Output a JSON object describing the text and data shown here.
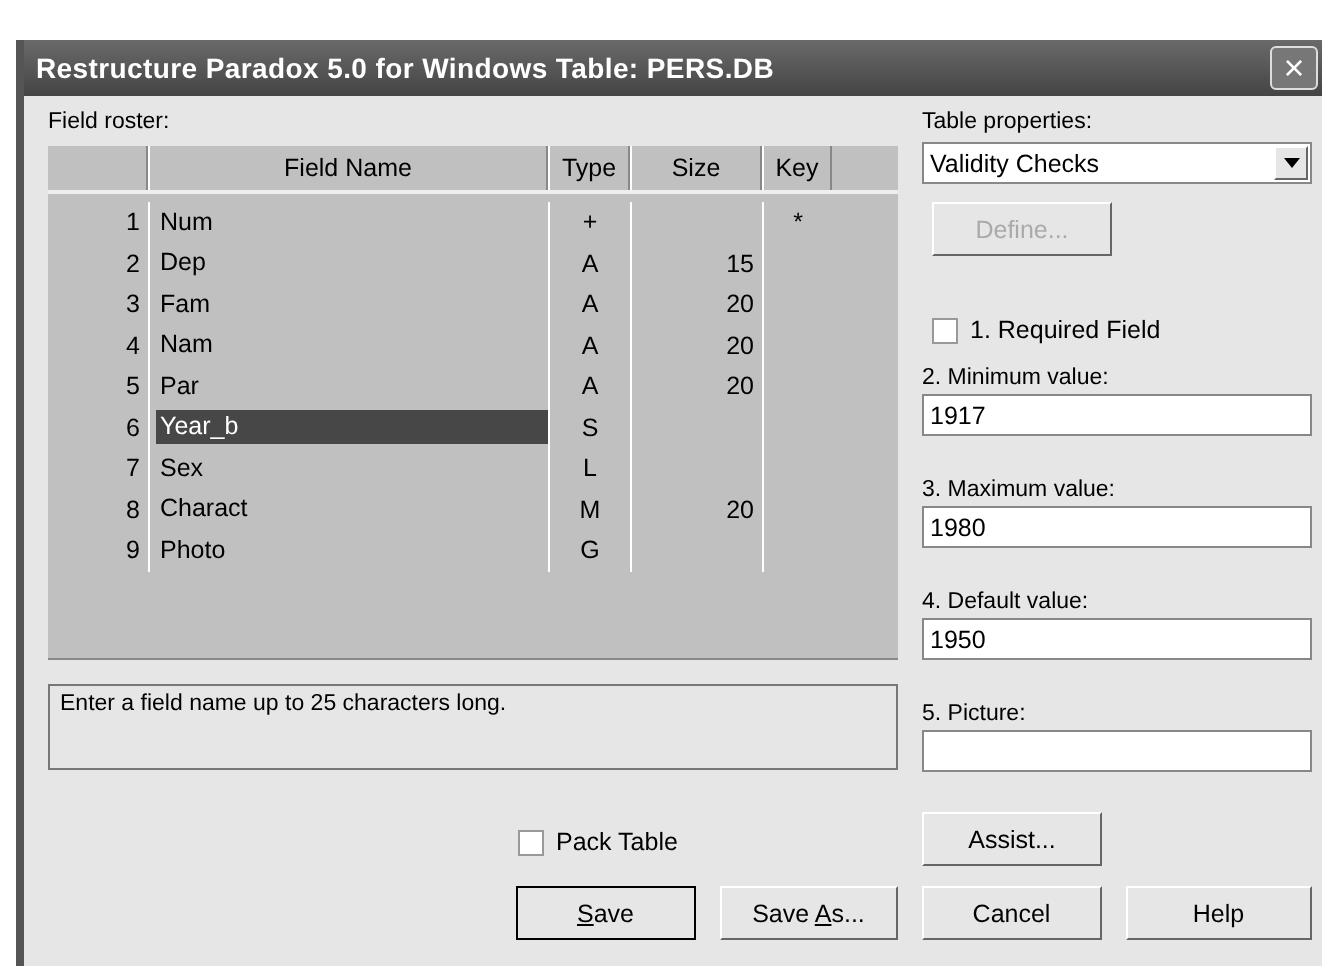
{
  "window": {
    "title": "Restructure Paradox 5.0 for Windows Table: PERS.DB",
    "close": "×"
  },
  "roster": {
    "label": "Field roster:",
    "columns": [
      "Field Name",
      "Type",
      "Size",
      "Key"
    ],
    "rows": [
      {
        "num": "1",
        "name": "Num",
        "type": "+",
        "size": "",
        "key": "*",
        "selected": false
      },
      {
        "num": "2",
        "name": "Dep",
        "type": "A",
        "size": "15",
        "key": "",
        "selected": false
      },
      {
        "num": "3",
        "name": "Fam",
        "type": "A",
        "size": "20",
        "key": "",
        "selected": false
      },
      {
        "num": "4",
        "name": "Nam",
        "type": "A",
        "size": "20",
        "key": "",
        "selected": false
      },
      {
        "num": "5",
        "name": "Par",
        "type": "A",
        "size": "20",
        "key": "",
        "selected": false
      },
      {
        "num": "6",
        "name": "Year_b",
        "type": "S",
        "size": "",
        "key": "",
        "selected": true
      },
      {
        "num": "7",
        "name": "Sex",
        "type": "L",
        "size": "",
        "key": "",
        "selected": false
      },
      {
        "num": "8",
        "name": "Charact",
        "type": "M",
        "size": "20",
        "key": "",
        "selected": false
      },
      {
        "num": "9",
        "name": "Photo",
        "type": "G",
        "size": "",
        "key": "",
        "selected": false
      }
    ]
  },
  "message": "Enter a field name up to 25 characters long.",
  "pack_table": {
    "label": "Pack Table",
    "checked": false
  },
  "properties": {
    "label": "Table properties:",
    "value": "Validity Checks",
    "define": {
      "label": "Define...",
      "disabled": true
    },
    "required": {
      "label": "1. Required Field",
      "checked": false
    },
    "fields": [
      {
        "label": "2. Minimum value:",
        "value": "1917"
      },
      {
        "label": "3. Maximum value:",
        "value": "1980"
      },
      {
        "label": "4. Default value:",
        "value": "1950"
      },
      {
        "label": "5. Picture:"
      }
    ],
    "assist": "Assist..."
  },
  "buttons": [
    {
      "label": [
        {
          "text": "S",
          "underline": true
        },
        {
          "text": "ave",
          "underline": false
        }
      ],
      "default": true
    },
    {
      "label": [
        {
          "text": "Save ",
          "underline": false
        },
        {
          "text": "A",
          "underline": true
        },
        {
          "text": "s...",
          "underline": false
        }
      ],
      "default": false
    },
    {
      "label": [
        {
          "text": "Cancel",
          "underline": false
        }
      ],
      "default": false
    },
    {
      "label": [
        {
          "text": "Help",
          "underline": false
        }
      ],
      "default": false
    }
  ]
}
